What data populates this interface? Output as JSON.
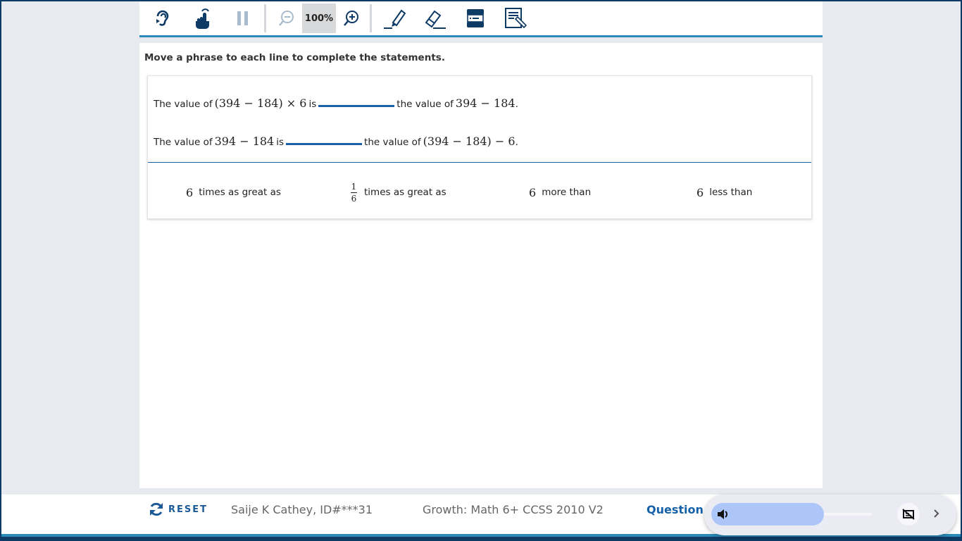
{
  "toolbar": {
    "tools": [
      {
        "name": "listen",
        "icon": "ear-icon"
      },
      {
        "name": "pointer",
        "icon": "hand-pointer-icon"
      },
      {
        "name": "pause",
        "icon": "pause-icon"
      },
      {
        "name": "zoom-out",
        "icon": "zoom-out-icon"
      },
      {
        "name": "zoom-in",
        "icon": "zoom-in-icon"
      },
      {
        "name": "highlighter",
        "icon": "highlighter-icon"
      },
      {
        "name": "eraser",
        "icon": "eraser-icon"
      },
      {
        "name": "line-reader",
        "icon": "line-reader-icon"
      },
      {
        "name": "notepad",
        "icon": "notepad-icon"
      }
    ],
    "zoom_level": "100%"
  },
  "question": {
    "instructions": "Move a phrase to each line to complete the statements.",
    "statements": [
      {
        "prefix": "The value of",
        "expr1": "(394 − 184) × 6",
        "mid": "is",
        "suffix": "the value of",
        "expr2": "394 − 184",
        "end": "."
      },
      {
        "prefix": "The value of",
        "expr1": "394 − 184",
        "mid": "is",
        "suffix": "the value of",
        "expr2": "(394 − 184) − 6",
        "end": "."
      }
    ],
    "phrases": [
      {
        "num": "6",
        "text": "times as great as"
      },
      {
        "num_top": "1",
        "num_bottom": "6",
        "text": "times as great as"
      },
      {
        "num": "6",
        "text": "more than"
      },
      {
        "num": "6",
        "text": "less than"
      }
    ]
  },
  "footer": {
    "reset_label": "RESET",
    "student": "Saije K Cathey, ID#***31",
    "test": "Growth: Math 6+ CCSS 2010 V2",
    "question_label": "Question #"
  },
  "media": {
    "volume_percent": 70
  },
  "colors": {
    "primary": "#0e3a66",
    "accent": "#2a8ab8",
    "link": "#1560a8",
    "blank_line": "#1960a8"
  }
}
